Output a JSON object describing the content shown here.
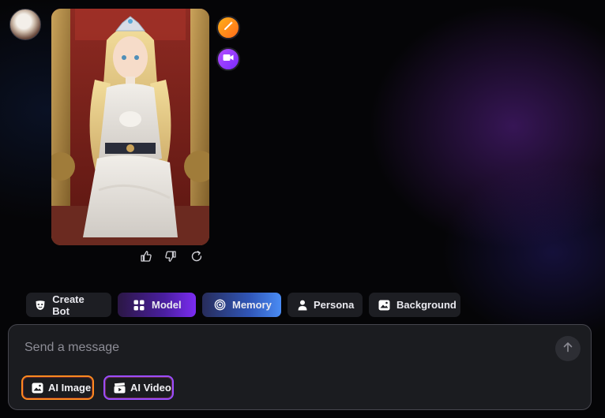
{
  "input": {
    "placeholder": "Send a message",
    "value": ""
  },
  "toolbar": {
    "create_bot": "Create Bot",
    "model": "Model",
    "memory": "Memory",
    "persona": "Persona",
    "background": "Background"
  },
  "modes": {
    "ai_image": "AI Image",
    "ai_video": "AI Video"
  },
  "icons": {
    "side_top": "magic-wand-icon",
    "side_bottom": "video-camera-icon",
    "feedback": [
      "thumbs-up-icon",
      "thumbs-down-icon",
      "regenerate-icon"
    ],
    "send": "arrow-up-icon"
  },
  "colors": {
    "background": "#050507",
    "composer_bg": "#1b1c20",
    "chip_bg": "#1d1e23",
    "model_gradient_end": "#7b2cf2",
    "memory_gradient_end": "#4a8cf4",
    "ai_image_border": "#ff8a1f",
    "ai_video_border": "#9b4dff"
  }
}
